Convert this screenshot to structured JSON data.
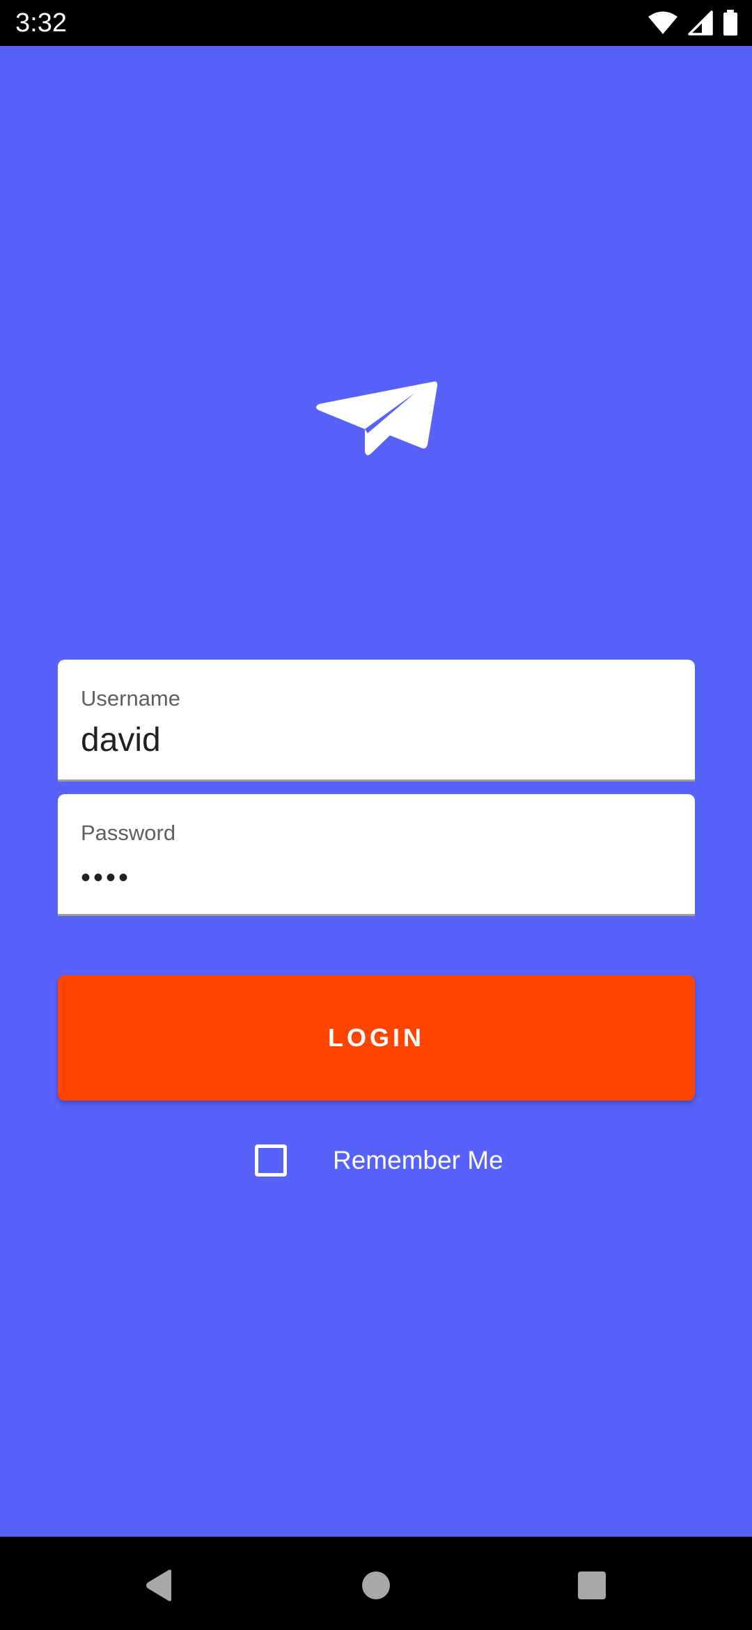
{
  "status_bar": {
    "time": "3:32",
    "icons": [
      "wifi-icon",
      "signal-icon",
      "battery-icon"
    ]
  },
  "app": {
    "logo_icon": "paper-plane-icon",
    "background_color": "#5762f9"
  },
  "form": {
    "username": {
      "label": "Username",
      "value": "david"
    },
    "password": {
      "label": "Password",
      "value": "••••"
    },
    "login_button_label": "LOGIN",
    "login_button_color": "#ff4500",
    "remember_me": {
      "label": "Remember Me",
      "checked": false
    }
  },
  "nav_bar": {
    "buttons": [
      "back-icon",
      "home-icon",
      "recents-icon"
    ]
  }
}
